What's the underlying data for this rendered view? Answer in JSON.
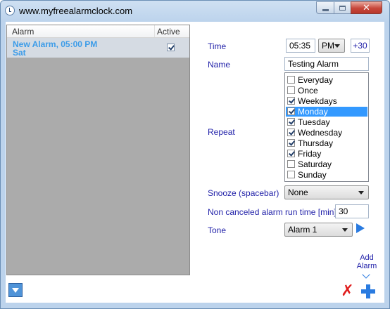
{
  "window": {
    "title": "www.myfreealarmclock.com",
    "close_glyph": "✕"
  },
  "alarm_list": {
    "columns": {
      "alarm": "Alarm",
      "active": "Active"
    },
    "rows": [
      {
        "line1": "New Alarm, 05:00 PM",
        "line2": "Sat",
        "active": true
      }
    ]
  },
  "form": {
    "time_label": "Time",
    "time_value": "05:35",
    "ampm_value": "PM",
    "plus30_label": "+30",
    "name_label": "Name",
    "name_value": "Testing Alarm",
    "repeat_label": "Repeat",
    "repeat_options": [
      {
        "label": "Everyday",
        "checked": false,
        "selected": false
      },
      {
        "label": "Once",
        "checked": false,
        "selected": false
      },
      {
        "label": "Weekdays",
        "checked": true,
        "selected": false
      },
      {
        "label": "Monday",
        "checked": true,
        "selected": true
      },
      {
        "label": "Tuesday",
        "checked": true,
        "selected": false
      },
      {
        "label": "Wednesday",
        "checked": true,
        "selected": false
      },
      {
        "label": "Thursday",
        "checked": true,
        "selected": false
      },
      {
        "label": "Friday",
        "checked": true,
        "selected": false
      },
      {
        "label": "Saturday",
        "checked": false,
        "selected": false
      },
      {
        "label": "Sunday",
        "checked": false,
        "selected": false
      }
    ],
    "snooze_label": "Snooze (spacebar)",
    "snooze_value": "None",
    "noncancel_label": "Non canceled alarm run time [min]",
    "noncancel_value": "30",
    "tone_label": "Tone",
    "tone_value": "Alarm 1"
  },
  "actions": {
    "add_alarm_line1": "Add",
    "add_alarm_line2": "Alarm",
    "delete_glyph": "✗"
  },
  "icons": {
    "app": "alarm-clock-icon",
    "import": "download-arrow-icon",
    "play": "play-icon",
    "delete": "delete-icon",
    "add": "add-plus-icon"
  },
  "colors": {
    "label_blue": "#1f1fa8",
    "alarm_text_blue": "#3d9ce8",
    "list_background": "#ababab",
    "selected_item": "#3399ff",
    "delete_red": "#e01d1d",
    "accent_blue": "#2a7be0"
  }
}
